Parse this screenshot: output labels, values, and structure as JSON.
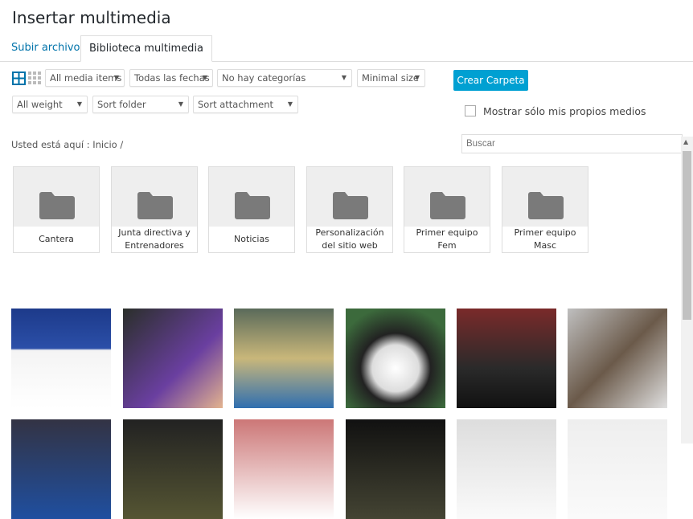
{
  "modal": {
    "title": "Insertar multimedia"
  },
  "tabs": [
    {
      "label": "Subir archivos"
    },
    {
      "label": "Biblioteca multimedia"
    }
  ],
  "filters": {
    "media_type": "All media items",
    "dates": "Todas las fechas",
    "categories": "No hay categorías",
    "size": "Minimal size",
    "weight": "All weight",
    "sort_folder": "Sort folder",
    "sort_attachment": "Sort attachment"
  },
  "create_folder": "Crear Carpeta",
  "own_media_label": "Mostrar sólo mis propios medios",
  "breadcrumb": {
    "label": "Usted está aquí",
    "sep": ":",
    "home": "Inicio",
    "slash": "/"
  },
  "search": {
    "placeholder": "Buscar"
  },
  "folders": [
    "Cantera",
    "Junta directiva y Entrenadores",
    "Noticias",
    "Personalización del sitio web",
    "Primer equipo Fem",
    "Primer equipo Masc"
  ],
  "colors": {
    "accent": "#00a0d2",
    "link": "#0073aa"
  }
}
